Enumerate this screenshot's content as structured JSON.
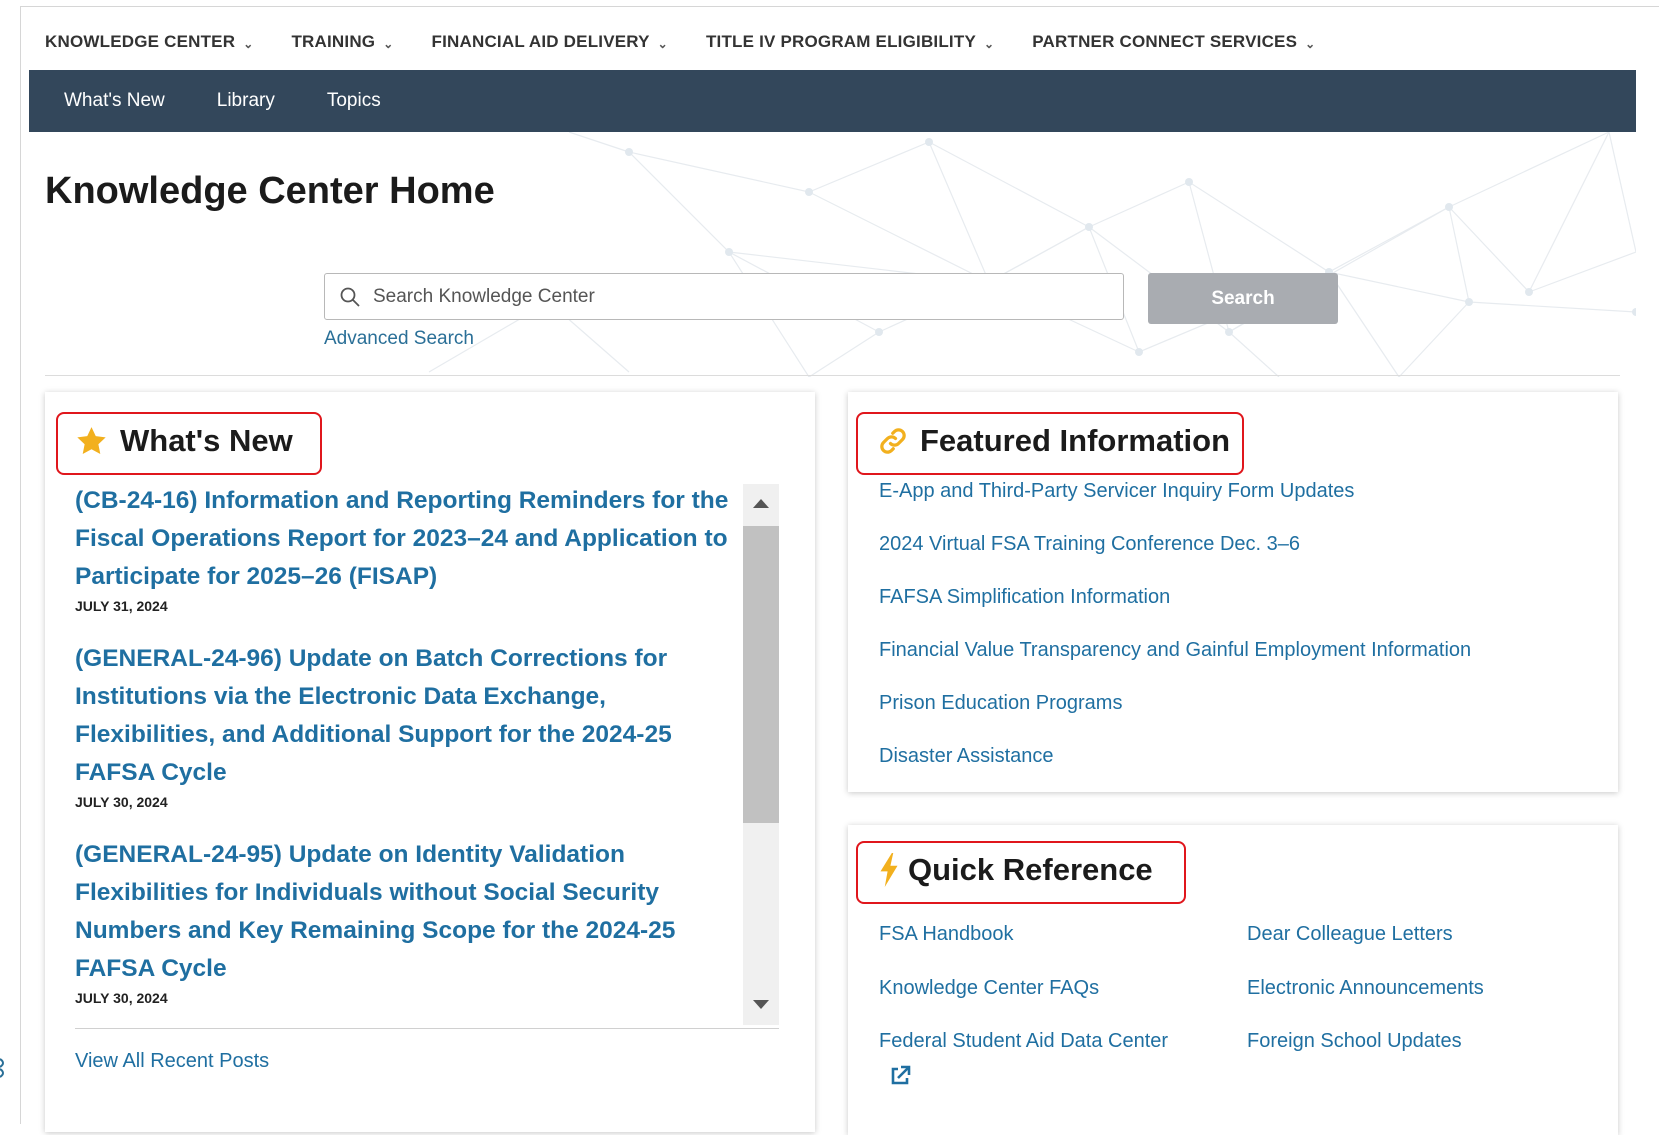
{
  "topnav": {
    "items": [
      {
        "label": "KNOWLEDGE CENTER"
      },
      {
        "label": "TRAINING"
      },
      {
        "label": "FINANCIAL AID DELIVERY"
      },
      {
        "label": "TITLE IV PROGRAM ELIGIBILITY"
      },
      {
        "label": "PARTNER CONNECT SERVICES"
      }
    ],
    "chevron_icon": "chevron-down-icon"
  },
  "subnav": {
    "items": [
      {
        "label": "What's New"
      },
      {
        "label": "Library"
      },
      {
        "label": "Topics"
      }
    ],
    "background": "#33475b"
  },
  "page": {
    "title": "Knowledge Center Home"
  },
  "search": {
    "placeholder": "Search Knowledge Center",
    "value": "",
    "button_label": "Search",
    "advanced_label": "Advanced Search",
    "icon": "search-icon"
  },
  "whats_new": {
    "title": "What's New",
    "icon": "star-icon",
    "items": [
      {
        "title": "(CB-24-16) Information and Reporting Reminders for the Fiscal Operations Report for 2023–24 and Application to Participate for 2025–26 (FISAP)",
        "date": "JULY 31, 2024"
      },
      {
        "title": "(GENERAL-24-96) Update on Batch Corrections for Institutions via the Electronic Data Exchange, Flexibilities, and Additional Support for the 2024-25 FAFSA Cycle",
        "date": "JULY 30, 2024"
      },
      {
        "title": "(GENERAL-24-95) Update on Identity Validation Flexibilities for Individuals without Social Security Numbers and Key Remaining Scope for the 2024-25 FAFSA Cycle",
        "date": "JULY 30, 2024"
      }
    ],
    "view_all_label": "View All Recent Posts"
  },
  "featured": {
    "title": "Featured Information",
    "icon": "link-icon",
    "links": [
      {
        "label": "E-App and Third-Party Servicer Inquiry Form Updates"
      },
      {
        "label": "2024 Virtual FSA Training Conference Dec. 3–6"
      },
      {
        "label": "FAFSA Simplification Information"
      },
      {
        "label": "Financial Value Transparency and Gainful Employment Information"
      },
      {
        "label": "Prison Education Programs"
      },
      {
        "label": "Disaster Assistance"
      }
    ]
  },
  "quick_reference": {
    "title": "Quick Reference",
    "icon": "lightning-bolt-icon",
    "links": [
      {
        "label": "FSA Handbook"
      },
      {
        "label": "Dear Colleague Letters"
      },
      {
        "label": "Knowledge Center FAQs"
      },
      {
        "label": "Electronic Announcements"
      },
      {
        "label": "Federal Student Aid Data Center"
      },
      {
        "label": "Foreign School Updates"
      }
    ],
    "external_icon": "external-link-icon"
  },
  "colors": {
    "link": "#1f6fa1",
    "highlight_box": "#e0161c",
    "icon_gold": "#f2b01e"
  }
}
